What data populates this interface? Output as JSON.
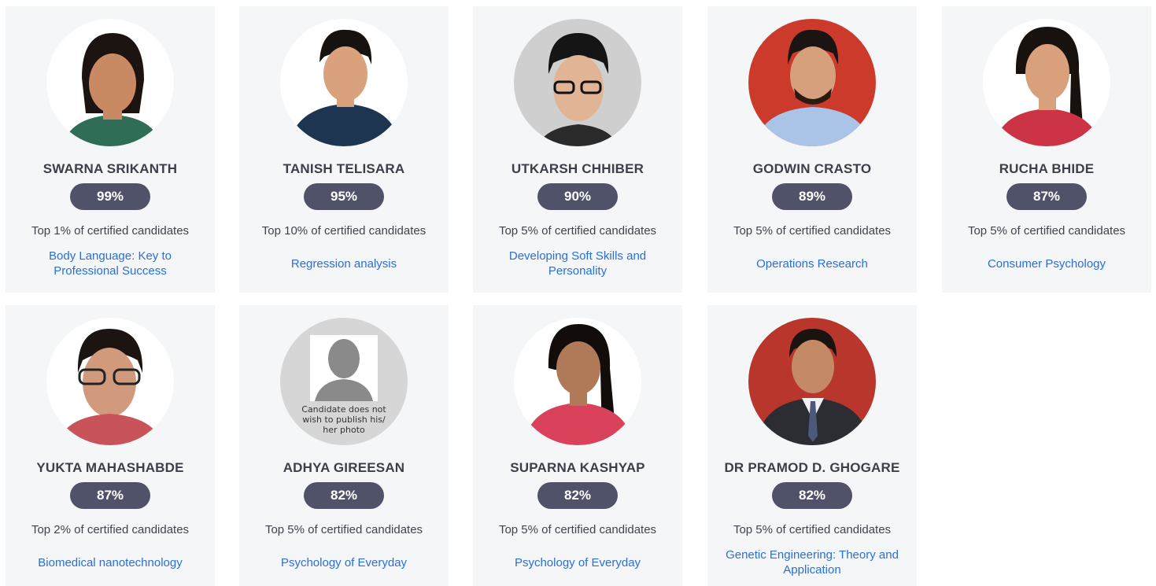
{
  "candidates": [
    {
      "name": "SWARNA SRIKANTH",
      "score": "99%",
      "rank": "Top 1% of certified candidates",
      "course": "Body Language: Key to Professional Success",
      "photo_bg": "#ffffff",
      "shirt": "#2f6d57",
      "skin": "#c98a63"
    },
    {
      "name": "TANISH TELISARA",
      "score": "95%",
      "rank": "Top 10% of certified candidates",
      "course": "Regression analysis",
      "photo_bg": "#ffffff",
      "shirt": "#1e3552",
      "skin": "#d9a27d"
    },
    {
      "name": "UTKARSH CHHIBER",
      "score": "90%",
      "rank": "Top 5% of certified candidates",
      "course": "Developing Soft Skills and Personality",
      "photo_bg": "#cfcfcf",
      "shirt": "#2a2a2a",
      "skin": "#e0b494"
    },
    {
      "name": "GODWIN CRASTO",
      "score": "89%",
      "rank": "Top 5% of certified candidates",
      "course": "Operations Research",
      "photo_bg": "#cc3a2c",
      "shirt": "#a9c4e6",
      "skin": "#d6a07c"
    },
    {
      "name": "RUCHA BHIDE",
      "score": "87%",
      "rank": "Top 5% of certified candidates",
      "course": "Consumer Psychology",
      "photo_bg": "#ffffff",
      "shirt": "#cc3344",
      "skin": "#d9a07c"
    },
    {
      "name": "YUKTA MAHASHABDE",
      "score": "87%",
      "rank": "Top 2% of certified candidates",
      "course": "Biomedical nanotechnology",
      "photo_bg": "#ffffff",
      "shirt": "#c8545a",
      "skin": "#d19a7c"
    },
    {
      "name": "ADHYA GIREESAN",
      "score": "82%",
      "rank": "Top 5% of certified candidates",
      "course": "Psychology of Everyday",
      "photo_bg": "#d6d6d6",
      "shirt": "#8a8a8a",
      "skin": "#8a8a8a",
      "placeholder_text": "Candidate does not wish to publish his/ her photo"
    },
    {
      "name": "SUPARNA KASHYAP",
      "score": "82%",
      "rank": "Top 5% of certified candidates",
      "course": "Psychology of Everyday",
      "photo_bg": "#ffffff",
      "shirt": "#d9425a",
      "skin": "#b07a58"
    },
    {
      "name": "DR PRAMOD D. GHOGARE",
      "score": "82%",
      "rank": "Top 5% of certified candidates",
      "course": "Genetic Engineering: Theory and Application",
      "photo_bg": "#b8362c",
      "shirt": "#2b2d33",
      "skin": "#c48a66"
    }
  ],
  "colors": {
    "card_bg": "#f5f6f8",
    "score_pill": "#50526a",
    "link": "#2a6fd6",
    "name_text": "#3b3f4a"
  }
}
